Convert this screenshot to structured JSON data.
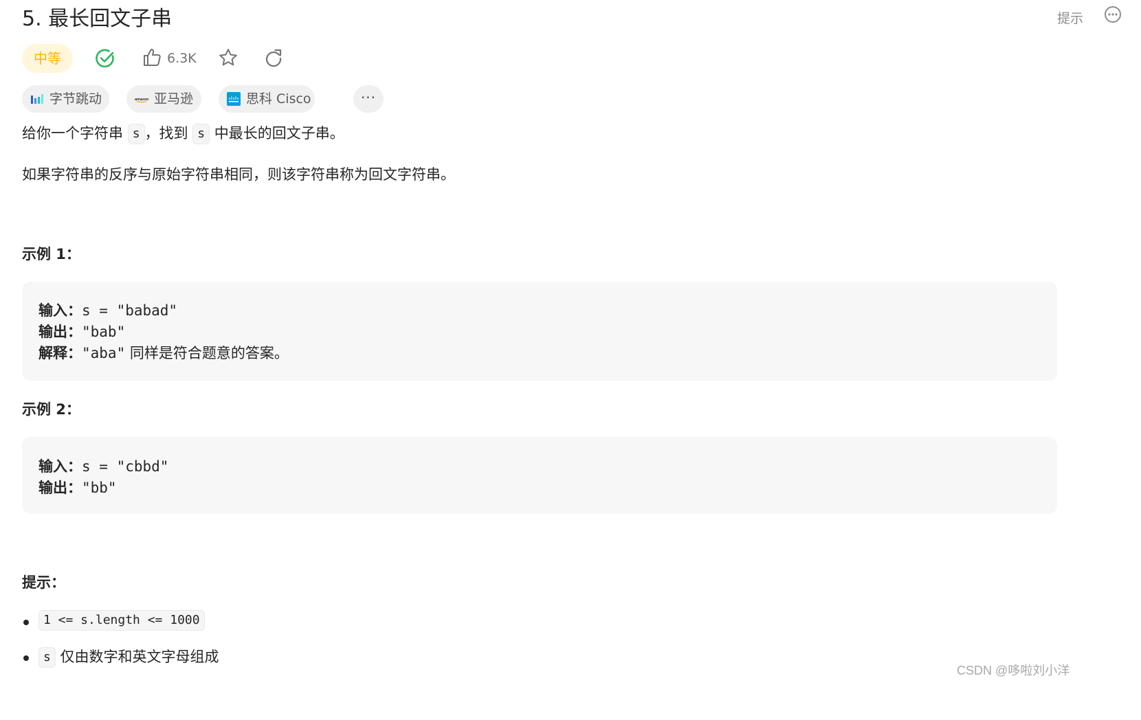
{
  "problem": {
    "title": "5. 最长回文子串",
    "hint_link": "提示",
    "difficulty": "中等",
    "likes": "6.3K"
  },
  "tags": [
    {
      "label": "字节跳动",
      "icon": "bytedance-logo"
    },
    {
      "label": "亚马逊",
      "icon": "amazon-logo"
    },
    {
      "label": "思科 Cisco",
      "icon": "cisco-logo"
    }
  ],
  "tags_more": "···",
  "description": {
    "line1_a": "给你一个字符串 ",
    "line1_code1": "s",
    "line1_b": "，找到 ",
    "line1_code2": "s",
    "line1_c": " 中最长的回文子串。",
    "line2": "如果字符串的反序与原始字符串相同，则该字符串称为回文字符串。"
  },
  "examples": [
    {
      "heading": "示例 1：",
      "input_label": "输入：",
      "input": "s = \"babad\"",
      "output_label": "输出：",
      "output": "\"bab\"",
      "explain_label": "解释：",
      "explain_code": "\"aba\"",
      "explain_text": " 同样是符合题意的答案。"
    },
    {
      "heading": "示例 2：",
      "input_label": "输入：",
      "input": "s = \"cbbd\"",
      "output_label": "输出：",
      "output": "\"bb\""
    }
  ],
  "constraints": {
    "heading": "提示：",
    "item1_code": "1 <= s.length <= 1000",
    "item2_code": "s",
    "item2_text": " 仅由数字和英文字母组成"
  },
  "watermark": "CSDN @哆啦刘小洋",
  "colors": {
    "difficulty_text": "#ffb800",
    "difficulty_bg": "#fff6db",
    "solved": "#2db55d",
    "cisco": "#049fd9",
    "bytedance": "#325ab4"
  }
}
